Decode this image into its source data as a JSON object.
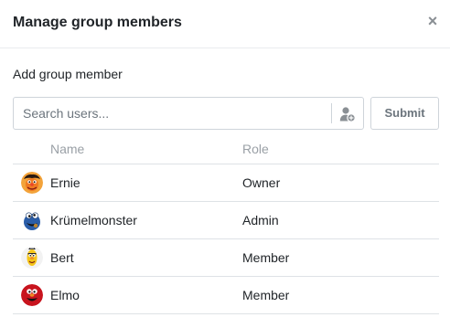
{
  "dialog": {
    "title": "Manage group members",
    "close_label": "×"
  },
  "add_member": {
    "label": "Add group member",
    "search_placeholder": "Search users...",
    "add_user_icon": "add-user-icon",
    "submit_label": "Submit"
  },
  "table": {
    "columns": [
      "Name",
      "Role"
    ],
    "rows": [
      {
        "name": "Ernie",
        "role": "Owner",
        "avatar": "ernie-avatar"
      },
      {
        "name": "Krümelmonster",
        "role": "Admin",
        "avatar": "cookie-monster-avatar"
      },
      {
        "name": "Bert",
        "role": "Member",
        "avatar": "bert-avatar"
      },
      {
        "name": "Elmo",
        "role": "Member",
        "avatar": "elmo-avatar"
      }
    ]
  },
  "colors": {
    "text": "#212529",
    "muted": "#6c757d",
    "border": "#ced4da",
    "header_text": "#9aa0a6"
  }
}
